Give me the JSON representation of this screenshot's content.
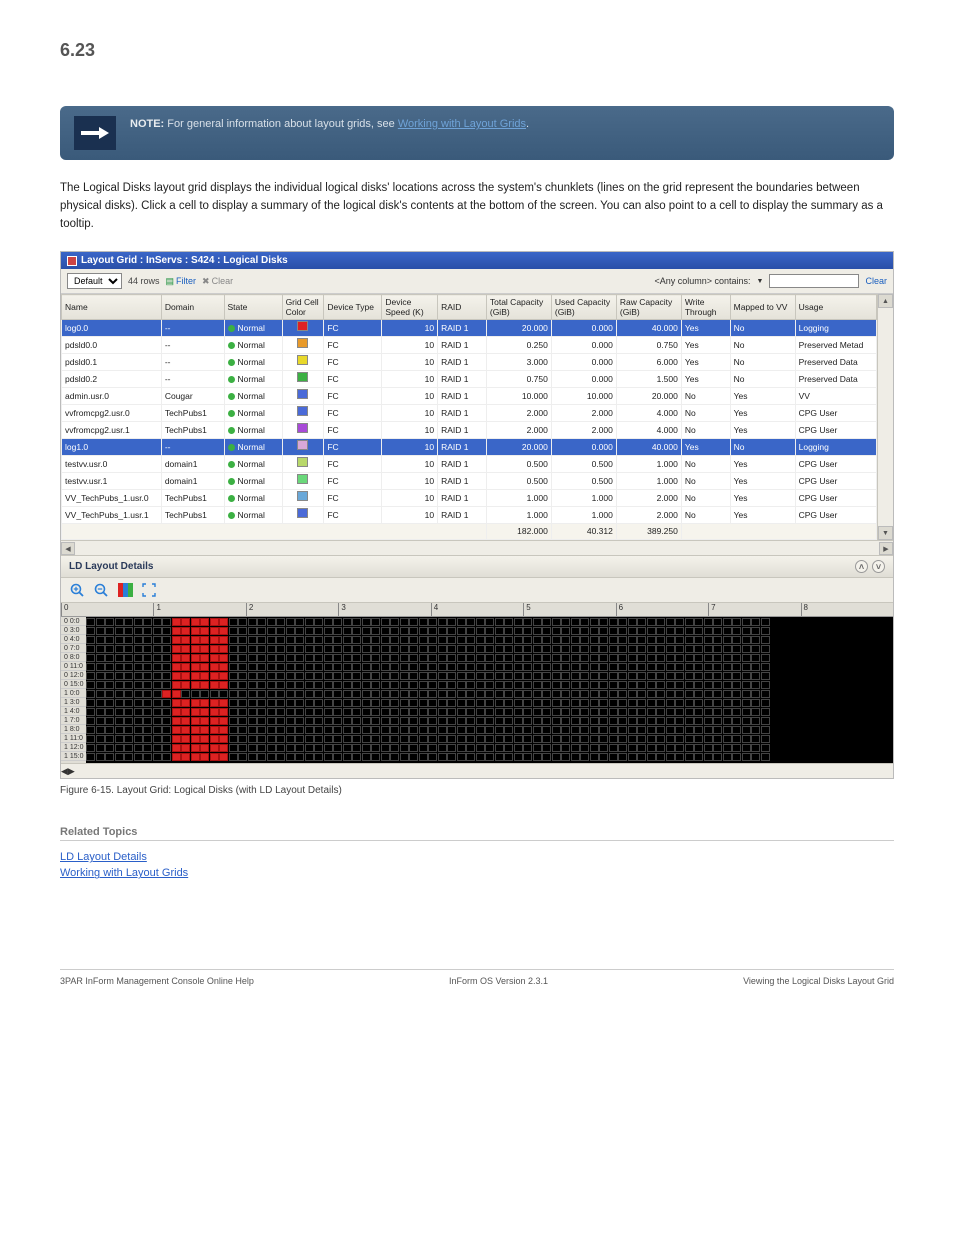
{
  "page": {
    "header_number": "6.23",
    "note_label": "NOTE:",
    "note_text_prefix": "For general information about layout grids, see ",
    "note_link_text": "Working with Layout Grids",
    "note_text_suffix": ".",
    "paragraph": "The Logical Disks layout grid displays the individual logical disks' locations across the system's chunklets (lines on the grid represent the boundaries between physical disks). Click a cell to display a summary of the logical disk's contents at the bottom of the screen. You can also point to a cell to display the summary as a tooltip.",
    "caption": "Figure 6-15.  Layout Grid: Logical Disks (with LD Layout Details)",
    "related_header": "Related Topics",
    "related_links": [
      "LD Layout Details",
      "Working with Layout Grids"
    ],
    "footer_left": "3PAR InForm Management Console Online Help",
    "footer_center": "InForm OS Version 2.3.1",
    "footer_right": "Viewing the Logical Disks Layout Grid"
  },
  "window": {
    "title": "Layout Grid : InServs : S424 : Logical Disks",
    "dropdown_value": "Default",
    "row_count_label": "44 rows",
    "filter_label": "Filter",
    "clear_toolbar_label": "Clear",
    "search_label": "<Any column> contains:",
    "search_value": "",
    "clear_label": "Clear",
    "columns": [
      "Name",
      "Domain",
      "State",
      "Grid Cell Color",
      "Device Type",
      "Device Speed (K)",
      "RAID",
      "Total Capacity (GiB)",
      "Used Capacity (GiB)",
      "Raw Capacity (GiB)",
      "Write Through",
      "Mapped to VV",
      "Usage"
    ],
    "rows": [
      {
        "name": "log0.0",
        "domain": "--",
        "state": "Normal",
        "color": "#d22",
        "devtype": "FC",
        "speed": "10",
        "raid": "RAID 1",
        "total": "20.000",
        "used": "0.000",
        "raw": "40.000",
        "wt": "Yes",
        "mapped": "No",
        "usage": "Logging",
        "sel": true
      },
      {
        "name": "pdsld0.0",
        "domain": "--",
        "state": "Normal",
        "color": "#e89a2a",
        "devtype": "FC",
        "speed": "10",
        "raid": "RAID 1",
        "total": "0.250",
        "used": "0.000",
        "raw": "0.750",
        "wt": "Yes",
        "mapped": "No",
        "usage": "Preserved Metad"
      },
      {
        "name": "pdsld0.1",
        "domain": "--",
        "state": "Normal",
        "color": "#e8d82a",
        "devtype": "FC",
        "speed": "10",
        "raid": "RAID 1",
        "total": "3.000",
        "used": "0.000",
        "raw": "6.000",
        "wt": "Yes",
        "mapped": "No",
        "usage": "Preserved Data"
      },
      {
        "name": "pdsld0.2",
        "domain": "--",
        "state": "Normal",
        "color": "#3cb043",
        "devtype": "FC",
        "speed": "10",
        "raid": "RAID 1",
        "total": "0.750",
        "used": "0.000",
        "raw": "1.500",
        "wt": "Yes",
        "mapped": "No",
        "usage": "Preserved Data"
      },
      {
        "name": "admin.usr.0",
        "domain": "Cougar",
        "state": "Normal",
        "color": "#4a6ad8",
        "devtype": "FC",
        "speed": "10",
        "raid": "RAID 1",
        "total": "10.000",
        "used": "10.000",
        "raw": "20.000",
        "wt": "No",
        "mapped": "Yes",
        "usage": "VV"
      },
      {
        "name": "vvfromcpg2.usr.0",
        "domain": "TechPubs1",
        "state": "Normal",
        "color": "#4a6ad8",
        "devtype": "FC",
        "speed": "10",
        "raid": "RAID 1",
        "total": "2.000",
        "used": "2.000",
        "raw": "4.000",
        "wt": "No",
        "mapped": "Yes",
        "usage": "CPG User"
      },
      {
        "name": "vvfromcpg2.usr.1",
        "domain": "TechPubs1",
        "state": "Normal",
        "color": "#a84ad8",
        "devtype": "FC",
        "speed": "10",
        "raid": "RAID 1",
        "total": "2.000",
        "used": "2.000",
        "raw": "4.000",
        "wt": "No",
        "mapped": "Yes",
        "usage": "CPG User"
      },
      {
        "name": "log1.0",
        "domain": "--",
        "state": "Normal",
        "color": "#d8a8d8",
        "devtype": "FC",
        "speed": "10",
        "raid": "RAID 1",
        "total": "20.000",
        "used": "0.000",
        "raw": "40.000",
        "wt": "Yes",
        "mapped": "No",
        "usage": "Logging",
        "sel": true
      },
      {
        "name": "testvv.usr.0",
        "domain": "domain1",
        "state": "Normal",
        "color": "#b8d86a",
        "devtype": "FC",
        "speed": "10",
        "raid": "RAID 1",
        "total": "0.500",
        "used": "0.500",
        "raw": "1.000",
        "wt": "No",
        "mapped": "Yes",
        "usage": "CPG User"
      },
      {
        "name": "testvv.usr.1",
        "domain": "domain1",
        "state": "Normal",
        "color": "#6ad87a",
        "devtype": "FC",
        "speed": "10",
        "raid": "RAID 1",
        "total": "0.500",
        "used": "0.500",
        "raw": "1.000",
        "wt": "No",
        "mapped": "Yes",
        "usage": "CPG User"
      },
      {
        "name": "VV_TechPubs_1.usr.0",
        "domain": "TechPubs1",
        "state": "Normal",
        "color": "#6aa8d8",
        "devtype": "FC",
        "speed": "10",
        "raid": "RAID 1",
        "total": "1.000",
        "used": "1.000",
        "raw": "2.000",
        "wt": "No",
        "mapped": "Yes",
        "usage": "CPG User"
      },
      {
        "name": "VV_TechPubs_1.usr.1",
        "domain": "TechPubs1",
        "state": "Normal",
        "color": "#4a6ad8",
        "devtype": "FC",
        "speed": "10",
        "raid": "RAID 1",
        "total": "1.000",
        "used": "1.000",
        "raw": "2.000",
        "wt": "No",
        "mapped": "Yes",
        "usage": "CPG User"
      }
    ],
    "totals": {
      "total": "182.000",
      "used": "40.312",
      "raw": "389.250"
    },
    "detail_header": "LD Layout Details",
    "ruler_labels": [
      "0",
      "1",
      "2",
      "3",
      "4",
      "5",
      "6",
      "7",
      "8"
    ],
    "row_labels": [
      "0 0:0",
      "0 3:0",
      "0 4:0",
      "0 7:0",
      "0 8:0",
      "0 11:0",
      "0 12:0",
      "0 15:0",
      "1 0:0",
      "1 3:0",
      "1 4:0",
      "1 7:0",
      "1 8:0",
      "1 11:0",
      "1 12:0",
      "1 15:0"
    ],
    "layout_red_zone": {
      "rows_with_block": [
        0,
        1,
        2,
        3,
        4,
        5,
        6,
        7,
        9,
        10,
        11,
        12,
        13,
        14,
        15
      ],
      "short_row": 8,
      "col_start": 9,
      "col_end": 14,
      "short_col_start": 8,
      "short_col_end": 9
    }
  }
}
